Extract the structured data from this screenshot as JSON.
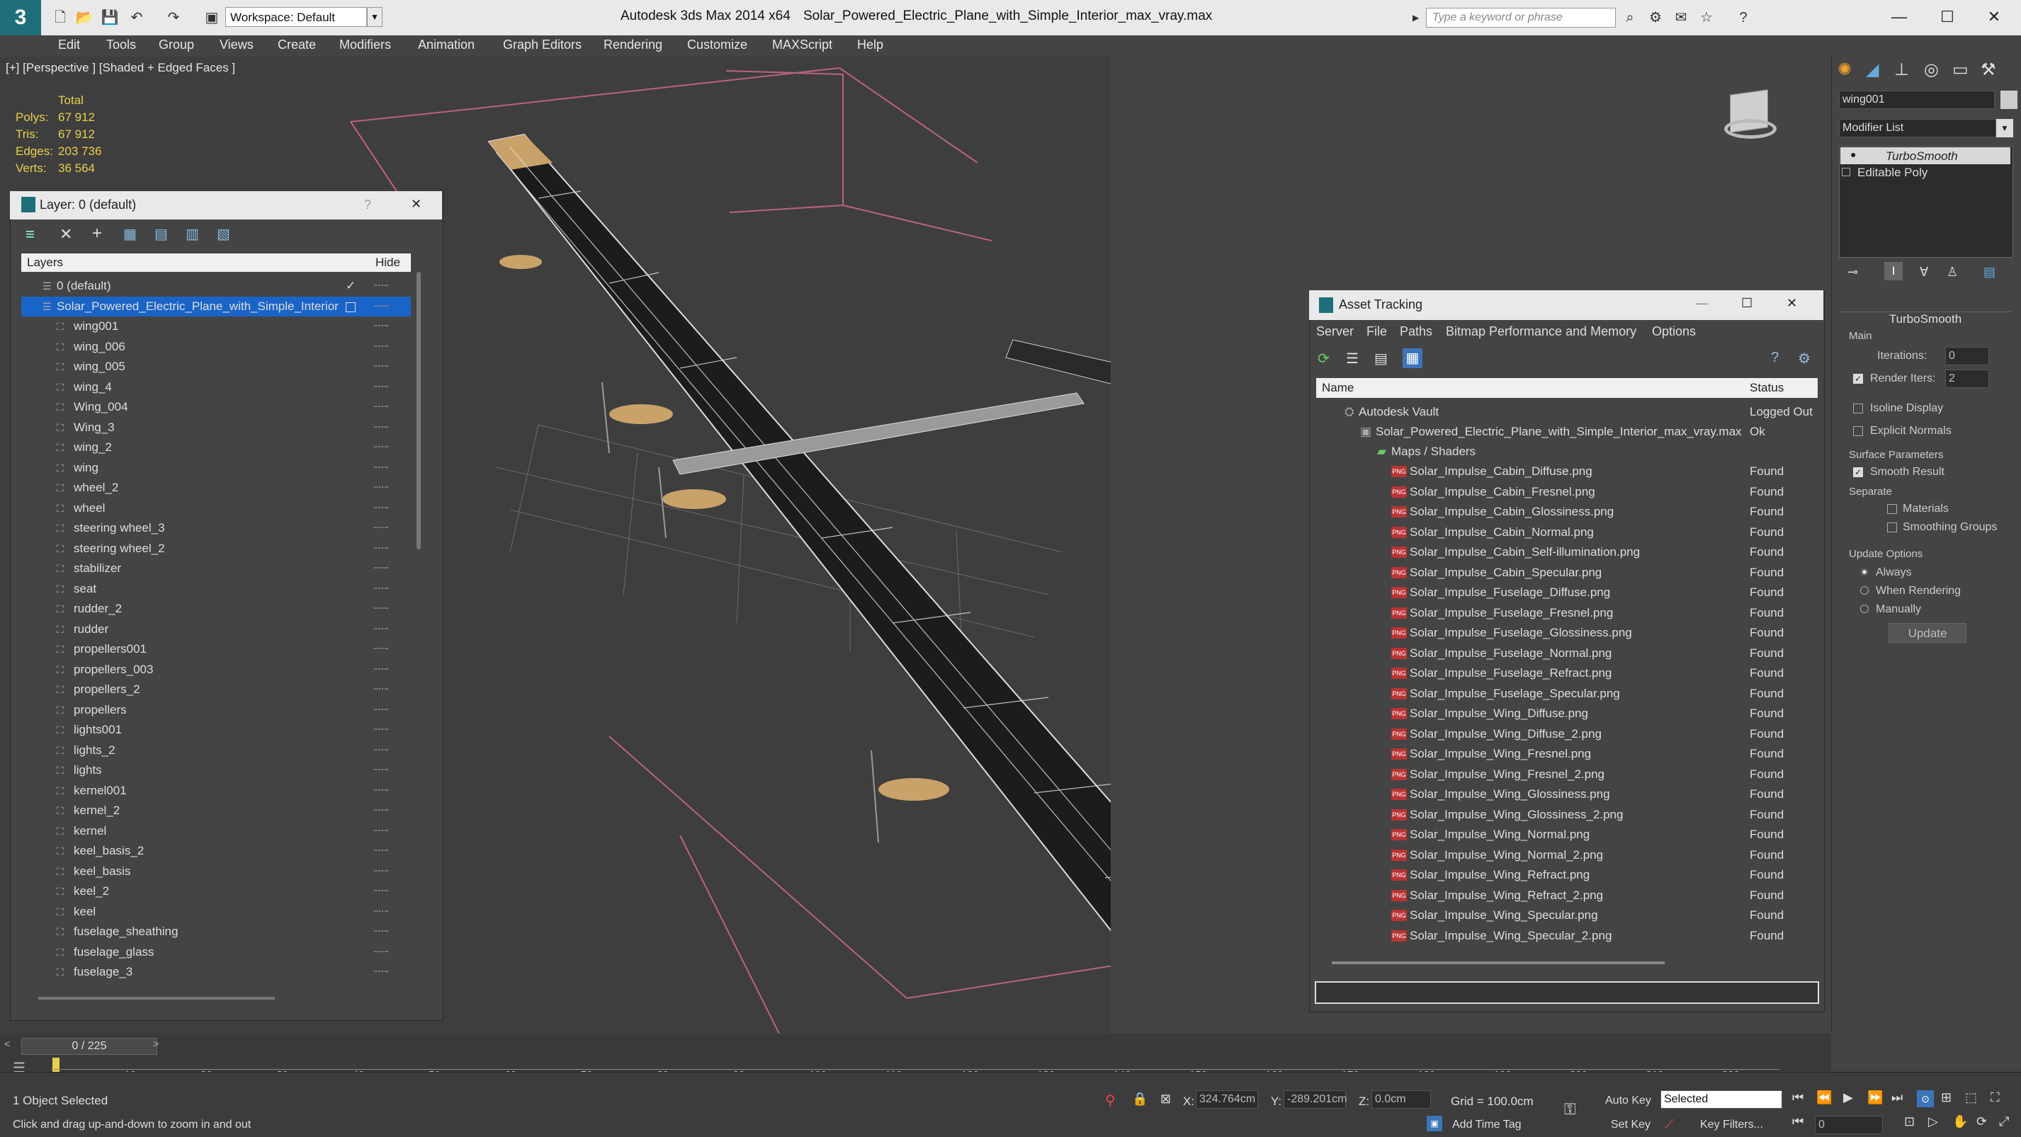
{
  "titlebar": {
    "logo": "3",
    "workspace_label": "Workspace: Default",
    "app_name": "Autodesk 3ds Max  2014 x64",
    "file_name": "Solar_Powered_Electric_Plane_with_Simple_Interior_max_vray.max",
    "search_placeholder": "Type a keyword or phrase"
  },
  "menu": [
    "Edit",
    "Tools",
    "Group",
    "Views",
    "Create",
    "Modifiers",
    "Animation",
    "Graph Editors",
    "Rendering",
    "Customize",
    "MAXScript",
    "Help"
  ],
  "viewport": {
    "label": "[+] [Perspective ] [Shaded + Edged Faces ]",
    "stats_header": "Total",
    "stats": [
      {
        "label": "Polys:",
        "value": "67 912"
      },
      {
        "label": "Tris:",
        "value": "67 912"
      },
      {
        "label": "Edges:",
        "value": "203 736"
      },
      {
        "label": "Verts:",
        "value": "36 564"
      }
    ]
  },
  "layer_explorer": {
    "title": "Layer: 0 (default)",
    "help": "?",
    "close": "✕",
    "col_layers": "Layers",
    "col_hide": "Hide",
    "rows": [
      {
        "name": "0 (default)",
        "level": 0
      },
      {
        "name": "Solar_Powered_Electric_Plane_with_Simple_Interior",
        "level": 0
      },
      {
        "name": "wing001",
        "level": 1
      },
      {
        "name": "wing_006",
        "level": 1
      },
      {
        "name": "wing_005",
        "level": 1
      },
      {
        "name": "wing_4",
        "level": 1
      },
      {
        "name": "Wing_004",
        "level": 1
      },
      {
        "name": "Wing_3",
        "level": 1
      },
      {
        "name": "wing_2",
        "level": 1
      },
      {
        "name": "wing",
        "level": 1
      },
      {
        "name": "wheel_2",
        "level": 1
      },
      {
        "name": "wheel",
        "level": 1
      },
      {
        "name": "steering wheel_3",
        "level": 1
      },
      {
        "name": "steering wheel_2",
        "level": 1
      },
      {
        "name": "stabilizer",
        "level": 1
      },
      {
        "name": "seat",
        "level": 1
      },
      {
        "name": "rudder_2",
        "level": 1
      },
      {
        "name": "rudder",
        "level": 1
      },
      {
        "name": "propellers001",
        "level": 1
      },
      {
        "name": "propellers_003",
        "level": 1
      },
      {
        "name": "propellers_2",
        "level": 1
      },
      {
        "name": "propellers",
        "level": 1
      },
      {
        "name": "lights001",
        "level": 1
      },
      {
        "name": "lights_2",
        "level": 1
      },
      {
        "name": "lights",
        "level": 1
      },
      {
        "name": "kernel001",
        "level": 1
      },
      {
        "name": "kernel_2",
        "level": 1
      },
      {
        "name": "kernel",
        "level": 1
      },
      {
        "name": "keel_basis_2",
        "level": 1
      },
      {
        "name": "keel_basis",
        "level": 1
      },
      {
        "name": "keel_2",
        "level": 1
      },
      {
        "name": "keel",
        "level": 1
      },
      {
        "name": "fuselage_sheathing",
        "level": 1
      },
      {
        "name": "fuselage_glass",
        "level": 1
      },
      {
        "name": "fuselage_3",
        "level": 1
      }
    ]
  },
  "asset_tracking": {
    "title": "Asset Tracking",
    "menu": [
      "Server",
      "File",
      "Paths",
      "Bitmap Performance and Memory",
      "Options"
    ],
    "col_name": "Name",
    "col_status": "Status",
    "vault": {
      "name": "Autodesk Vault",
      "status": "Logged Out"
    },
    "file": {
      "name": "Solar_Powered_Electric_Plane_with_Simple_Interior_max_vray.max",
      "status": "Ok"
    },
    "group": "Maps / Shaders",
    "maps": [
      {
        "name": "Solar_Impulse_Cabin_Diffuse.png",
        "status": "Found"
      },
      {
        "name": "Solar_Impulse_Cabin_Fresnel.png",
        "status": "Found"
      },
      {
        "name": "Solar_Impulse_Cabin_Glossiness.png",
        "status": "Found"
      },
      {
        "name": "Solar_Impulse_Cabin_Normal.png",
        "status": "Found"
      },
      {
        "name": "Solar_Impulse_Cabin_Self-illumination.png",
        "status": "Found"
      },
      {
        "name": "Solar_Impulse_Cabin_Specular.png",
        "status": "Found"
      },
      {
        "name": "Solar_Impulse_Fuselage_Diffuse.png",
        "status": "Found"
      },
      {
        "name": "Solar_Impulse_Fuselage_Fresnel.png",
        "status": "Found"
      },
      {
        "name": "Solar_Impulse_Fuselage_Glossiness.png",
        "status": "Found"
      },
      {
        "name": "Solar_Impulse_Fuselage_Normal.png",
        "status": "Found"
      },
      {
        "name": "Solar_Impulse_Fuselage_Refract.png",
        "status": "Found"
      },
      {
        "name": "Solar_Impulse_Fuselage_Specular.png",
        "status": "Found"
      },
      {
        "name": "Solar_Impulse_Wing_Diffuse.png",
        "status": "Found"
      },
      {
        "name": "Solar_Impulse_Wing_Diffuse_2.png",
        "status": "Found"
      },
      {
        "name": "Solar_Impulse_Wing_Fresnel.png",
        "status": "Found"
      },
      {
        "name": "Solar_Impulse_Wing_Fresnel_2.png",
        "status": "Found"
      },
      {
        "name": "Solar_Impulse_Wing_Glossiness.png",
        "status": "Found"
      },
      {
        "name": "Solar_Impulse_Wing_Glossiness_2.png",
        "status": "Found"
      },
      {
        "name": "Solar_Impulse_Wing_Normal.png",
        "status": "Found"
      },
      {
        "name": "Solar_Impulse_Wing_Normal_2.png",
        "status": "Found"
      },
      {
        "name": "Solar_Impulse_Wing_Refract.png",
        "status": "Found"
      },
      {
        "name": "Solar_Impulse_Wing_Refract_2.png",
        "status": "Found"
      },
      {
        "name": "Solar_Impulse_Wing_Specular.png",
        "status": "Found"
      },
      {
        "name": "Solar_Impulse_Wing_Specular_2.png",
        "status": "Found"
      }
    ]
  },
  "command_panel": {
    "object_name": "wing001",
    "modifier_list": "Modifier List",
    "stack": [
      "TurboSmooth",
      "Editable Poly"
    ],
    "rollout_title": "TurboSmooth",
    "main_group": "Main",
    "iterations_label": "Iterations:",
    "iterations_value": "0",
    "render_iters_label": "Render Iters:",
    "render_iters_value": "2",
    "isoline": "Isoline Display",
    "explicit_normals": "Explicit Normals",
    "surface_params": "Surface Parameters",
    "smooth_result": "Smooth Result",
    "separate": "Separate",
    "materials": "Materials",
    "smoothing_groups": "Smoothing Groups",
    "update_options": "Update Options",
    "always": "Always",
    "when_rendering": "When Rendering",
    "manually": "Manually",
    "update_button": "Update"
  },
  "timeline": {
    "frame_counter": "0 / 225",
    "ticks": [
      "10",
      "20",
      "30",
      "40",
      "50",
      "60",
      "70",
      "80",
      "90",
      "100",
      "110",
      "120",
      "130",
      "140",
      "150",
      "160",
      "170",
      "180",
      "190",
      "200",
      "210",
      "220"
    ]
  },
  "status": {
    "selection": "1 Object Selected",
    "prompt": "Click and drag up-and-down to zoom in and out",
    "x_label": "X:",
    "x_value": "324.764cm",
    "y_label": "Y:",
    "y_value": "-289.201cm",
    "z_label": "Z:",
    "z_value": "0.0cm",
    "grid": "Grid = 100.0cm",
    "auto_key": "Auto Key",
    "selected": "Selected",
    "set_key": "Set Key",
    "key_filters": "Key Filters...",
    "add_time_tag": "Add Time Tag",
    "frame": "0"
  },
  "colors": {
    "accent": "#1f6f7a",
    "stat_yellow": "#e8cf4c",
    "selection_blue": "#1a64c8",
    "wire_pink": "#d06a8a"
  }
}
